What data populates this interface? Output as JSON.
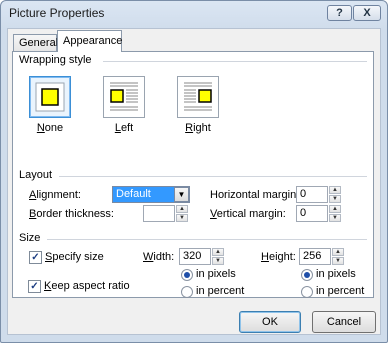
{
  "window": {
    "title": "Picture Properties",
    "help_glyph": "?",
    "close_glyph": "X"
  },
  "tabs": [
    {
      "label": "General"
    },
    {
      "label": "Appearance"
    }
  ],
  "wrapping": {
    "group_title": "Wrapping style",
    "options": [
      {
        "label": "None",
        "mnemonic": "N",
        "rest": "one",
        "selected": true
      },
      {
        "label": "Left",
        "mnemonic": "L",
        "rest": "eft",
        "selected": false
      },
      {
        "label": "Right",
        "mnemonic": "R",
        "rest": "ight",
        "selected": false
      }
    ]
  },
  "layout": {
    "group_title": "Layout",
    "alignment_mn": "A",
    "alignment_rest": "lignment:",
    "alignment_value": "Default",
    "border_mn": "B",
    "border_rest": "order thickness:",
    "border_value": "",
    "hmargin_pre": "Horizontal margin:",
    "hmargin_value": "0",
    "vmargin_mn": "V",
    "vmargin_rest": "ertical margin:",
    "vmargin_value": "0"
  },
  "size": {
    "group_title": "Size",
    "specify_pre": "S",
    "specify_rest": "pecify size",
    "specify_checked": true,
    "width_mn": "W",
    "width_rest": "idth:",
    "width_value": "320",
    "height_mn": "H",
    "height_rest": "eight:",
    "height_value": "256",
    "width_pixels": "in pixels",
    "width_percent": "in percent",
    "height_pixels": "in pixels",
    "height_percent": "in percent",
    "width_unit": "pixels",
    "height_unit": "pixels",
    "keep_mn": "K",
    "keep_rest": "eep aspect ratio",
    "keep_checked": true
  },
  "buttons": {
    "ok": "OK",
    "cancel": "Cancel"
  },
  "colors": {
    "accent": "#3399ff",
    "selected_border": "#3b8fd6",
    "swatch_fill": "#ffff00"
  }
}
